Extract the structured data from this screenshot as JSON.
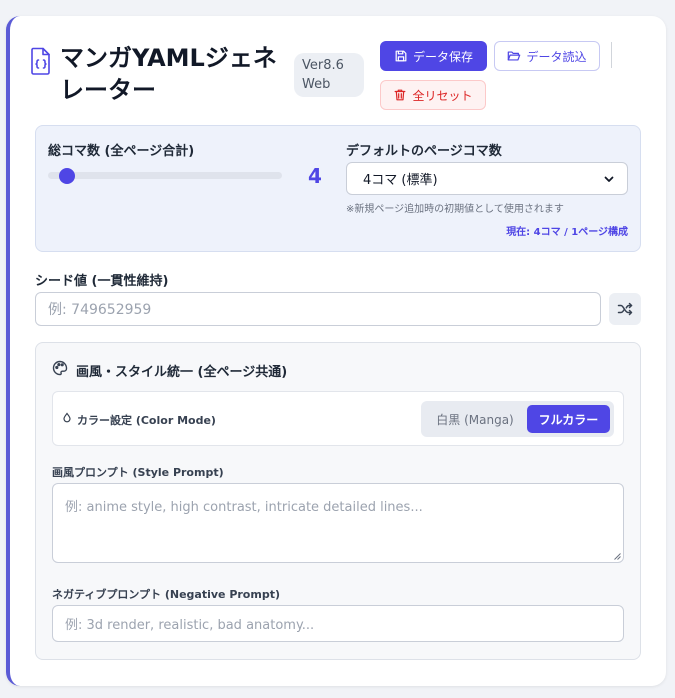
{
  "header": {
    "title": "マンガYAMLジェネレーター",
    "version": "Ver8.6 Web",
    "save_label": "データ保存",
    "load_label": "データ読込",
    "reset_label": "全リセット"
  },
  "panel_settings": {
    "total_label": "総コマ数 (全ページ合計)",
    "total_value": "4",
    "slider_fraction": 0.05,
    "default_label": "デフォルトのページコマ数",
    "default_selected": "4コマ (標準)",
    "hint": "※新規ページ追加時の初期値として使用されます",
    "status": "現在: 4コマ / 1ページ構成"
  },
  "seed": {
    "label": "シード値 (一貫性維持)",
    "placeholder": "例: 749652959"
  },
  "style_section": {
    "title": "画風・スタイル統一 (全ページ共通)",
    "color_label": "カラー設定 (Color Mode)",
    "mono_label": "白黒 (Manga)",
    "full_label": "フルカラー",
    "style_prompt_label": "画風プロンプト (Style Prompt)",
    "style_prompt_placeholder": "例: anime style, high contrast, intricate detailed lines...",
    "negative_label": "ネガティブプロンプト (Negative Prompt)",
    "negative_placeholder": "例: 3d render, realistic, bad anatomy..."
  },
  "colors": {
    "accent": "#4f46e5",
    "danger": "#dc2626",
    "card_border": "#5b5bd6"
  },
  "icons": [
    "file-code-icon",
    "save-icon",
    "folder-open-icon",
    "trash-icon",
    "shuffle-icon",
    "palette-icon",
    "droplet-icon",
    "chevron-down-icon"
  ]
}
